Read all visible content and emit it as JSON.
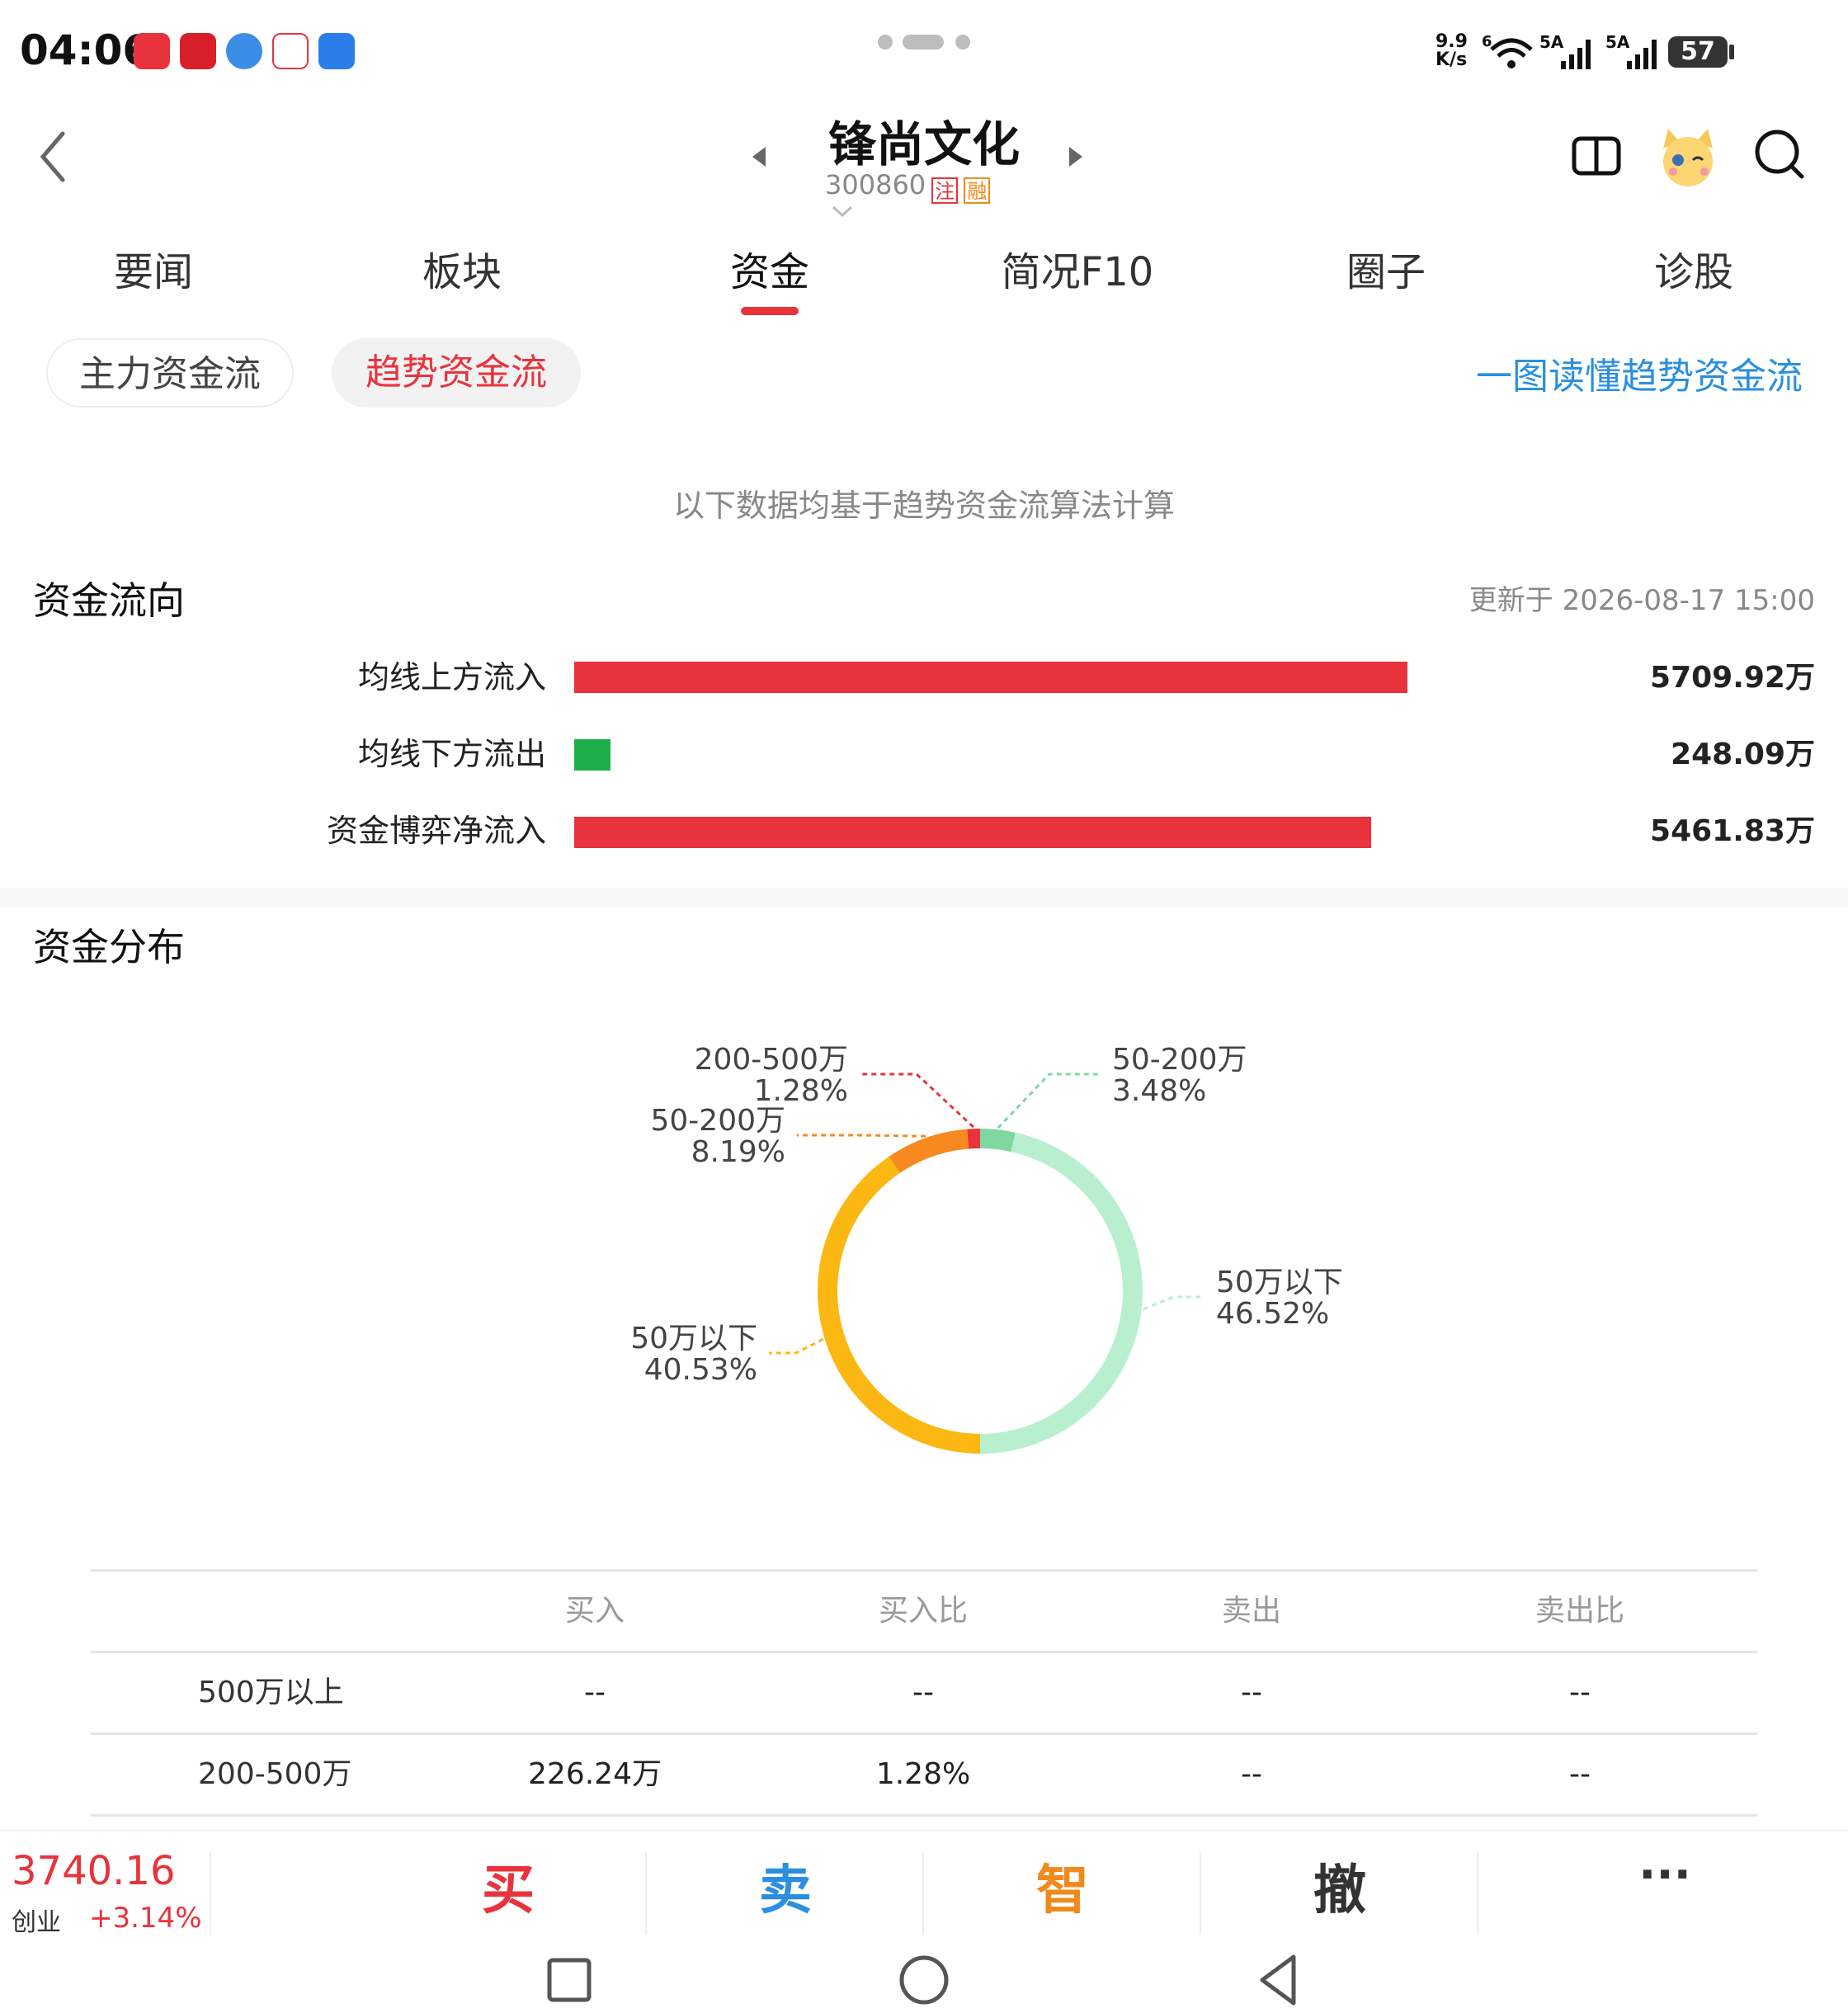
{
  "status_bar": {
    "time": "04:06",
    "net_speed_top": "9.9",
    "net_speed_bottom": "K/s",
    "signal_1": "5A",
    "signal_2": "5A",
    "wifi_label": "6",
    "battery": "57"
  },
  "header": {
    "stock_name": "锋尚文化",
    "stock_code": "300860",
    "tag_1": "注",
    "tag_2": "融"
  },
  "tabs": [
    {
      "label": "要闻"
    },
    {
      "label": "板块"
    },
    {
      "label": "资金",
      "active": true
    },
    {
      "label": "简况F10"
    },
    {
      "label": "圈子"
    },
    {
      "label": "诊股"
    }
  ],
  "subtabs": {
    "main": "主力资金流",
    "trend": "趋势资金流",
    "explain_link": "一图读懂趋势资金流"
  },
  "note": "以下数据均基于趋势资金流算法计算",
  "flow": {
    "title": "资金流向",
    "updated": "更新于 2026-08-17 15:00",
    "rows": [
      {
        "label": "均线上方流入",
        "value": "5709.92万",
        "amount": 5709.92,
        "color": "#e8333d"
      },
      {
        "label": "均线下方流出",
        "value": "248.09万",
        "amount": 248.09,
        "color": "#1db04a"
      },
      {
        "label": "资金博弈净流入",
        "value": "5461.83万",
        "amount": 5461.83,
        "color": "#e8333d"
      }
    ]
  },
  "distribution": {
    "title": "资金分布",
    "table": {
      "headers": [
        "买入",
        "买入比",
        "卖出",
        "卖出比"
      ],
      "rows": [
        {
          "label": "500万以上",
          "cells": [
            "--",
            "--",
            "--",
            "--"
          ]
        },
        {
          "label": "200-500万",
          "cells": [
            "226.24万",
            "1.28%",
            "--",
            "--"
          ]
        }
      ]
    }
  },
  "chart_data": {
    "type": "pie",
    "slices": [
      {
        "label": "200-500万",
        "value": 1.28,
        "value_label": "1.28%",
        "color": "#e8333d",
        "side": "buy"
      },
      {
        "label": "50-200万",
        "value": 3.48,
        "value_label": "3.48%",
        "color": "#7fd8a0",
        "side": "sell"
      },
      {
        "label": "50万以下",
        "value": 46.52,
        "value_label": "46.52%",
        "color": "#b8f0cf",
        "side": "sell"
      },
      {
        "label": "50万以下",
        "value": 40.53,
        "value_label": "40.53%",
        "color": "#fbb812",
        "side": "buy"
      },
      {
        "label": "50-200万",
        "value": 8.19,
        "value_label": "8.19%",
        "color": "#f68a1e",
        "side": "buy"
      }
    ]
  },
  "bottom_bar": {
    "index_value": "3740.16",
    "index_name": "创业",
    "index_change": "+3.14%",
    "actions": [
      {
        "label": "买",
        "color": "#e8333d"
      },
      {
        "label": "卖",
        "color": "#2a8fe0"
      },
      {
        "label": "智",
        "color": "#f08a1c"
      },
      {
        "label": "撤",
        "color": "#333333"
      },
      {
        "label": "···",
        "color": "#333333"
      }
    ]
  }
}
